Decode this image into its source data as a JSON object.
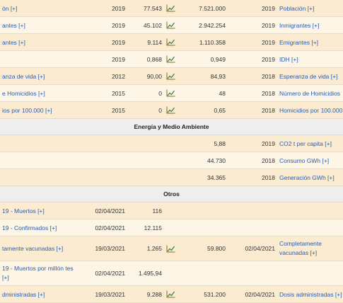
{
  "rows": [
    {
      "type": "row",
      "style": "alt",
      "left_label": "ón [+]",
      "left_year": "2019",
      "left_value": "77.543",
      "chart_icon": true,
      "right_value": "7.521.000",
      "right_year": "2019",
      "right_label": "Población [+]"
    },
    {
      "type": "row",
      "style": "plain",
      "left_label": "antes [+]",
      "left_year": "2019",
      "left_value": "45.102",
      "chart_icon": true,
      "right_value": "2.942.254",
      "right_year": "2019",
      "right_label": "Inmigrantes [+]"
    },
    {
      "type": "row",
      "style": "alt",
      "left_label": "antes [+]",
      "left_year": "2019",
      "left_value": "9.114",
      "chart_icon": true,
      "right_value": "1.110.358",
      "right_year": "2019",
      "right_label": "Emigrantes [+]"
    },
    {
      "type": "row",
      "style": "plain",
      "left_label": "",
      "left_year": "2019",
      "left_value": "0,868",
      "chart_icon": true,
      "right_value": "0,949",
      "right_year": "2019",
      "right_label": "IDH [+]"
    },
    {
      "type": "row",
      "style": "alt",
      "left_label": "anza de vida [+]",
      "left_year": "2012",
      "left_value": "90,00",
      "chart_icon": true,
      "right_value": "84,93",
      "right_year": "2018",
      "right_label": "Esperanza de vida [+]"
    },
    {
      "type": "row",
      "style": "plain",
      "left_label": "e Homicidios [+]",
      "left_year": "2015",
      "left_value": "0",
      "chart_icon": true,
      "right_value": "48",
      "right_year": "2018",
      "right_label": "Número de Homicidios"
    },
    {
      "type": "row",
      "style": "alt",
      "left_label": "ios por 100.000 [+]",
      "left_year": "2015",
      "left_value": "0",
      "chart_icon": true,
      "right_value": "0,65",
      "right_year": "2018",
      "right_label": "Homicidios por 100.000"
    },
    {
      "type": "section",
      "title": "Energía y Medio Ambiente"
    },
    {
      "type": "row",
      "style": "alt",
      "left_label": "",
      "left_year": "",
      "left_value": "",
      "chart_icon": false,
      "right_value": "5,88",
      "right_year": "2019",
      "right_label": "CO2 t per capita [+]"
    },
    {
      "type": "row",
      "style": "plain",
      "left_label": "",
      "left_year": "",
      "left_value": "",
      "chart_icon": false,
      "right_value": "44.730",
      "right_year": "2018",
      "right_label": "Consumo GWh [+]"
    },
    {
      "type": "row",
      "style": "alt",
      "left_label": "",
      "left_year": "",
      "left_value": "",
      "chart_icon": false,
      "right_value": "34.365",
      "right_year": "2018",
      "right_label": "Generación GWh [+]"
    },
    {
      "type": "section",
      "title": "Otros"
    },
    {
      "type": "row",
      "style": "alt",
      "left_label": "19 - Muertos [+]",
      "left_year": "02/04/2021",
      "left_value": "116",
      "chart_icon": false,
      "right_value": "",
      "right_year": "",
      "right_label": ""
    },
    {
      "type": "row",
      "style": "plain",
      "left_label": "19 - Confirmados [+]",
      "left_year": "02/04/2021",
      "left_value": "12.115",
      "chart_icon": false,
      "right_value": "",
      "right_year": "",
      "right_label": ""
    },
    {
      "type": "row",
      "style": "alt",
      "tall": true,
      "left_label": "tamente vacunadas [+]",
      "left_year": "19/03/2021",
      "left_value": "1.265",
      "chart_icon": true,
      "right_value": "59.800",
      "right_year": "02/04/2021",
      "right_label": "Completamente vacunadas [+]"
    },
    {
      "type": "row",
      "style": "plain",
      "tall": true,
      "left_label": "19 - Muertos por millón tes [+]",
      "left_year": "02/04/2021",
      "left_value": "1.495,94",
      "chart_icon": false,
      "right_value": "",
      "right_year": "",
      "right_label": ""
    },
    {
      "type": "row",
      "style": "alt",
      "left_label": "dministradas [+]",
      "left_year": "19/03/2021",
      "left_value": "9.288",
      "chart_icon": true,
      "right_value": "531.200",
      "right_year": "02/04/2021",
      "right_label": "Dosis administradas [+]"
    }
  ]
}
